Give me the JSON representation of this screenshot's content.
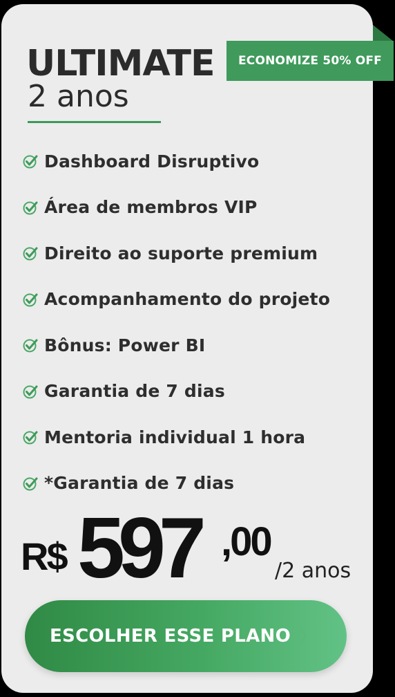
{
  "plan": {
    "name": "ULTIMATE",
    "duration": "2 anos"
  },
  "badge": {
    "label": "ECONOMIZE 50% OFF"
  },
  "features": [
    {
      "label": "Dashboard Disruptivo",
      "icon": "check-icon"
    },
    {
      "label": "Área de membros VIP",
      "icon": "check-icon"
    },
    {
      "label": "Direito ao suporte premium",
      "icon": "check-icon"
    },
    {
      "label": "Acompanhamento do projeto",
      "icon": "check-icon"
    },
    {
      "label": "Bônus: Power BI",
      "icon": "check-icon"
    },
    {
      "label": "Garantia de 7 dias",
      "icon": "check-icon"
    },
    {
      "label": "Mentoria individual 1 hora",
      "icon": "check-icon"
    },
    {
      "label": "*Garantia de 7 dias",
      "icon": "check-icon"
    }
  ],
  "price": {
    "currency": "R$",
    "amount": "597",
    "cents": ",00",
    "period": "/2 anos"
  },
  "cta": {
    "label": "ESCOLHER ESSE PLANO",
    "icon": "chevron-right-icon"
  },
  "colors": {
    "accent": "#3f9a5b",
    "card_background": "#ececec",
    "page_background": "#000000",
    "text": "#2e2e2e"
  }
}
